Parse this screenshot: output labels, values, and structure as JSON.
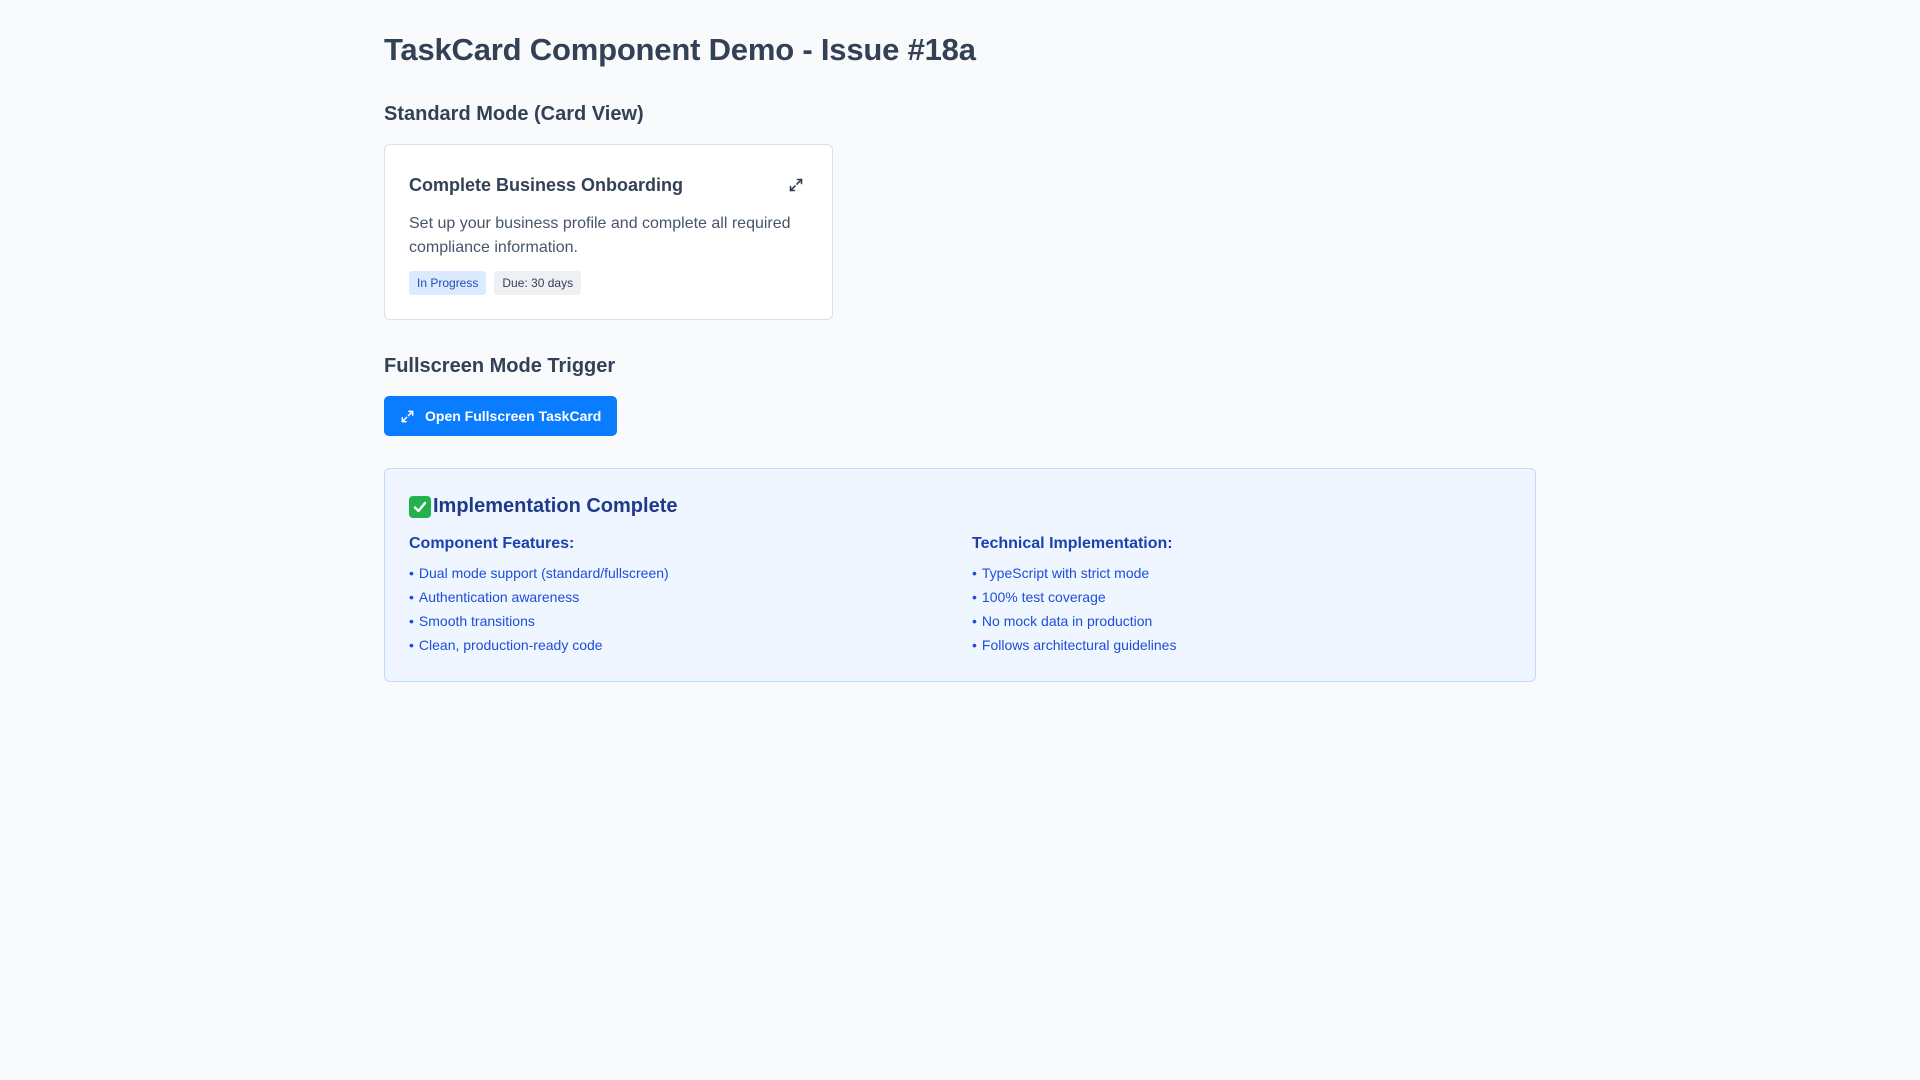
{
  "page": {
    "title": "TaskCard Component Demo - Issue #18a"
  },
  "standard_section": {
    "title": "Standard Mode (Card View)"
  },
  "task_card": {
    "title": "Complete Business Onboarding",
    "description": "Set up your business profile and complete all required compliance information.",
    "status_badge": "In Progress",
    "due_badge": "Due: 30 days",
    "expand_icon": "expand-icon"
  },
  "fullscreen_section": {
    "title": "Fullscreen Mode Trigger",
    "button_label": "Open Fullscreen TaskCard",
    "button_icon": "expand-icon"
  },
  "implementation": {
    "icon": "check-mark-icon",
    "heading": "Implementation Complete",
    "features": {
      "title": "Component Features:",
      "items": [
        "Dual mode support (standard/fullscreen)",
        "Authentication awareness",
        "Smooth transitions",
        "Clean, production-ready code"
      ]
    },
    "technical": {
      "title": "Technical Implementation:",
      "items": [
        "TypeScript with strict mode",
        "100% test coverage",
        "No mock data in production",
        "Follows architectural guidelines"
      ]
    }
  },
  "colors": {
    "background": "#f8fafc",
    "primary_button": "#0a7cff",
    "status_badge_bg": "#dbeafe",
    "success_box_bg": "#eff6ff",
    "success_text": "#1d4ed8",
    "check_green": "#22b14c"
  }
}
